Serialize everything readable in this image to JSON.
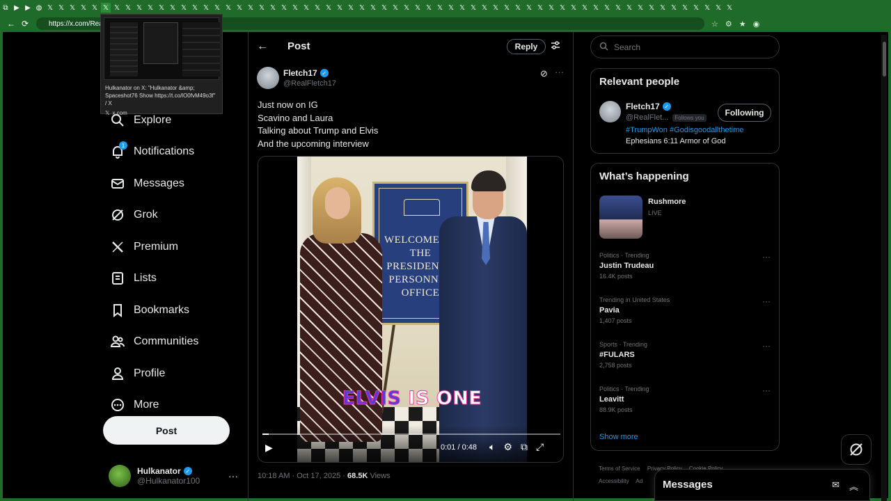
{
  "browser": {
    "url": "https://x.com/Real",
    "tab_count_icons": 66,
    "tab_preview": {
      "title": "Hulkanator on X: \"Hulkanator &amp; Spaceshot76 Show https://t.co/lO0fvM49o3f\" / X",
      "domain": "x.com"
    }
  },
  "nav": {
    "items": [
      {
        "label": "Explore",
        "icon": "search-icon"
      },
      {
        "label": "Notifications",
        "icon": "bell-icon",
        "badge": "1"
      },
      {
        "label": "Messages",
        "icon": "envelope-icon"
      },
      {
        "label": "Grok",
        "icon": "grok-icon"
      },
      {
        "label": "Premium",
        "icon": "x-logo-icon"
      },
      {
        "label": "Lists",
        "icon": "list-icon"
      },
      {
        "label": "Bookmarks",
        "icon": "bookmark-icon"
      },
      {
        "label": "Communities",
        "icon": "people-icon"
      },
      {
        "label": "Profile",
        "icon": "person-icon"
      },
      {
        "label": "More",
        "icon": "more-circle-icon"
      }
    ],
    "post_button": "Post",
    "account": {
      "name": "Hulkanator",
      "handle": "@Hulkanator100"
    }
  },
  "post_view": {
    "title": "Post",
    "reply_button": "Reply",
    "author": {
      "name": "Fletch17",
      "handle": "@RealFletch17"
    },
    "text_lines": [
      "Just now on IG",
      "Scavino and Laura",
      "Talking about Trump and Elvis",
      "And the upcoming interview"
    ],
    "video": {
      "sign_text": "WELCOME TO THE PRESIDENT'S PERSONNEL OFFICE",
      "caption_highlight": "ELVIS",
      "caption_rest": " IS ONE",
      "time": "0:01 / 0:48",
      "progress": 0.021
    },
    "timestamp": "10:18 AM · Oct 17, 2025 ·",
    "views_count": "68.5K",
    "views_label": "Views"
  },
  "sidebar": {
    "search_placeholder": "Search",
    "relevant": {
      "title": "Relevant people",
      "name": "Fletch17",
      "handle": "@RealFlet...",
      "follows_you": "Follows you",
      "button": "Following",
      "bio_tags": "#TrumpWon #Godisgoodallthetime",
      "bio_text": "Ephesians 6:11 Armor of God"
    },
    "happening": {
      "title": "What’s happening",
      "live": {
        "title": "Rushmore",
        "sub": "LIVE"
      },
      "trends": [
        {
          "context": "Politics · Trending",
          "topic": "Justin Trudeau",
          "count": "16.4K posts"
        },
        {
          "context": "Trending in United States",
          "topic": "Pavia",
          "count": "1,407 posts"
        },
        {
          "context": "Sports · Trending",
          "topic": "#FULARS",
          "count": "2,758 posts"
        },
        {
          "context": "Politics · Trending",
          "topic": "Leavitt",
          "count": "88.9K posts"
        }
      ],
      "show_more": "Show more"
    },
    "footer": [
      "Terms of Service",
      "Privacy Policy",
      "Cookie Policy",
      "Accessibility",
      "Ad"
    ]
  },
  "messages_drawer": {
    "title": "Messages"
  },
  "colors": {
    "accent": "#1d9bf0",
    "background": "#000000",
    "browser_frame": "#1f6b2a",
    "text": "#e7e9ea",
    "muted": "#71767b"
  }
}
